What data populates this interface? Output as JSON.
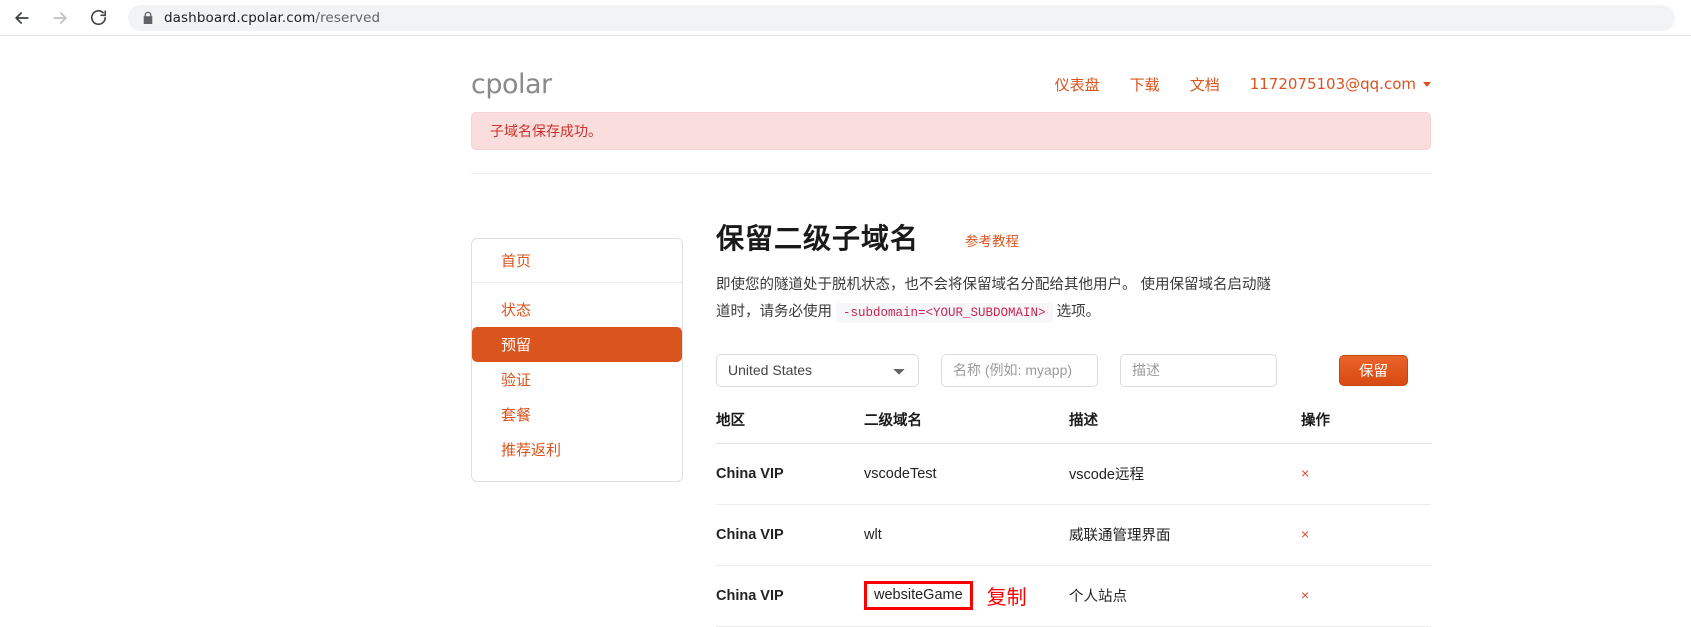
{
  "browser": {
    "back_icon": "back-arrow-icon",
    "forward_icon": "forward-arrow-icon",
    "reload_icon": "reload-icon",
    "lock_icon": "lock-icon",
    "url_domain": "dashboard.cpolar.com",
    "url_path": "/reserved"
  },
  "header": {
    "brand": "cpolar",
    "nav": [
      {
        "label": "仪表盘",
        "name": "nav-dashboard"
      },
      {
        "label": "下载",
        "name": "nav-download"
      },
      {
        "label": "文档",
        "name": "nav-docs"
      }
    ],
    "account": "1172075103@qq.com"
  },
  "alert": {
    "message": "子域名保存成功。",
    "bg": "#f9dedd",
    "text_color": "#c9322d"
  },
  "sidebar": {
    "home": "首页",
    "items": [
      {
        "label": "状态",
        "active": false
      },
      {
        "label": "预留",
        "active": true
      },
      {
        "label": "验证",
        "active": false
      },
      {
        "label": "套餐",
        "active": false
      },
      {
        "label": "推荐返利",
        "active": false
      }
    ],
    "active_color": "#d9541e"
  },
  "main": {
    "title": "保留二级子域名",
    "tutorial_link": "参考教程",
    "desc_part1": "即使您的隧道处于脱机状态，也不会将保留域名分配给其他用户。 使用保留域名启动隧道时，请务必使用",
    "desc_code": "-subdomain=<YOUR_SUBDOMAIN>",
    "desc_part2": "选项。"
  },
  "form": {
    "region_selected": "United States",
    "region_options": [
      "United States"
    ],
    "name_placeholder": "名称 (例如: myapp)",
    "name_value": "",
    "desc_placeholder": "描述",
    "desc_value": "",
    "submit_label": "保留"
  },
  "table": {
    "columns": [
      "地区",
      "二级域名",
      "描述",
      "操作"
    ],
    "rows": [
      {
        "region": "China VIP",
        "subdomain": "vscodeTest",
        "description": "vscode远程",
        "action": "×",
        "highlighted": false
      },
      {
        "region": "China VIP",
        "subdomain": "wlt",
        "description": "威联通管理界面",
        "action": "×",
        "highlighted": false
      },
      {
        "region": "China VIP",
        "subdomain": "websiteGame",
        "description": "个人站点",
        "action": "×",
        "highlighted": true
      }
    ]
  },
  "annotation": {
    "label": "复制",
    "color": "#fc0000"
  }
}
